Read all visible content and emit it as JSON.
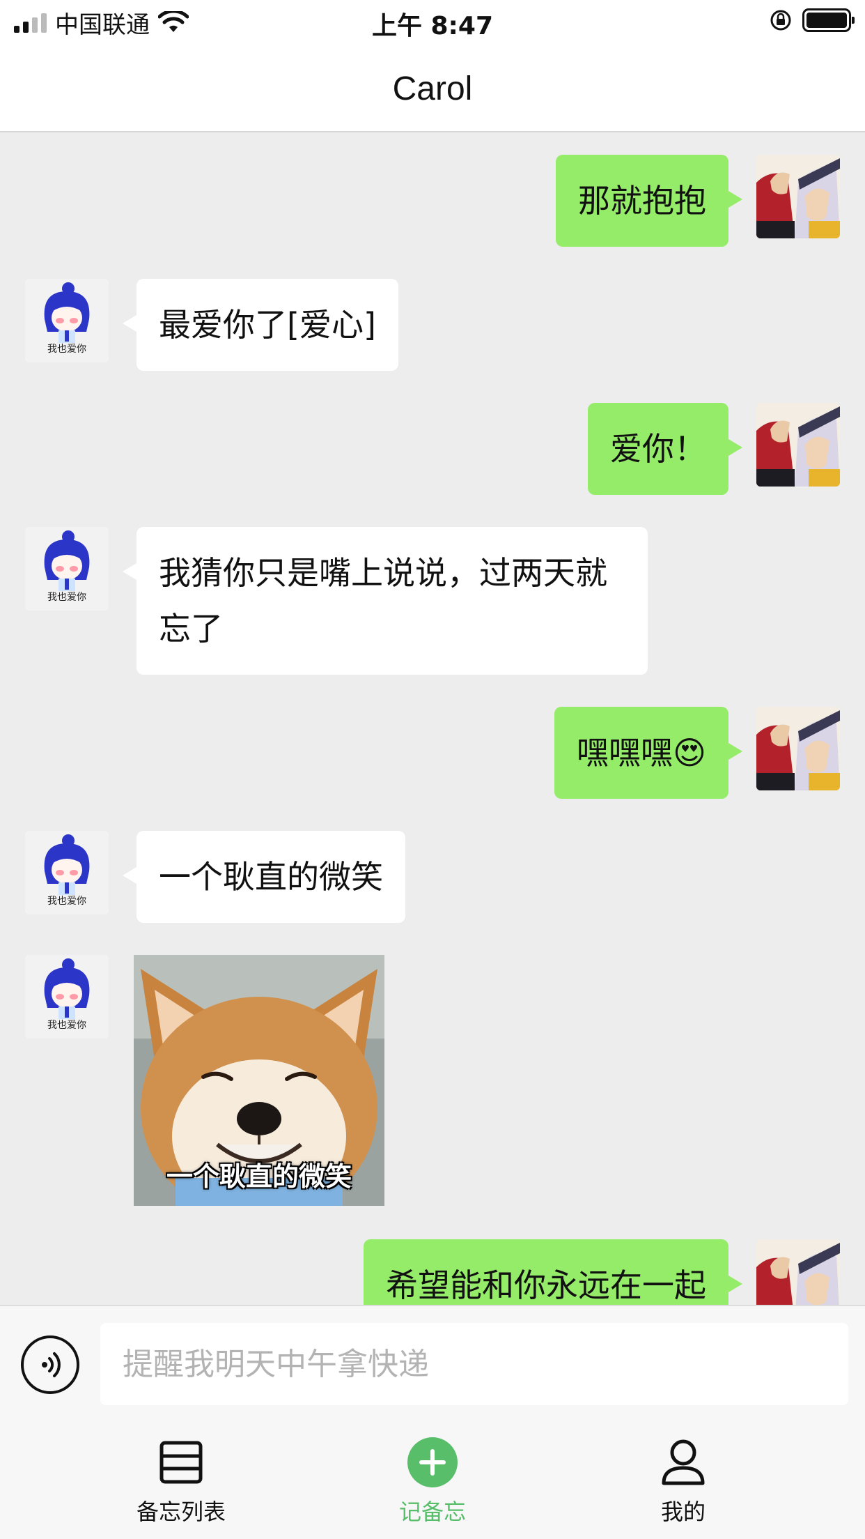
{
  "status_bar": {
    "carrier": "中国联通",
    "time": "上午 8:47"
  },
  "header": {
    "title": "Carol"
  },
  "messages": [
    {
      "side": "out",
      "text": "那就抱抱"
    },
    {
      "side": "in",
      "text": "最爱你了[爱心]",
      "avatar_caption": "我也爱你"
    },
    {
      "side": "out",
      "text": "爱你！"
    },
    {
      "side": "in",
      "text": "我猜你只是嘴上说说，过两天就\n忘了",
      "avatar_caption": "我也爱你"
    },
    {
      "side": "out",
      "text": "嘿嘿嘿😍"
    },
    {
      "side": "in",
      "text": "一个耿直的微笑",
      "avatar_caption": "我也爱你"
    },
    {
      "side": "in",
      "type": "image",
      "image_caption": "一个耿直的微笑",
      "avatar_caption": "我也爱你"
    },
    {
      "side": "out",
      "text": "希望能和你永远在一起"
    }
  ],
  "input_bar": {
    "placeholder": "提醒我明天中午拿快递"
  },
  "tabbar": {
    "items": [
      {
        "label": "备忘列表",
        "icon": "list-icon",
        "active": false
      },
      {
        "label": "记备忘",
        "icon": "add-circle-icon",
        "active": true
      },
      {
        "label": "我的",
        "icon": "person-icon",
        "active": false
      }
    ]
  },
  "colors": {
    "accent": "#58be6a",
    "outgoing_bubble": "#95ec69",
    "incoming_bubble": "#ffffff",
    "chat_background": "#ededed"
  }
}
